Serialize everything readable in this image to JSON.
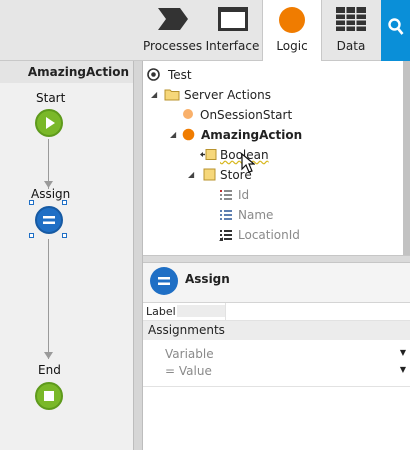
{
  "tabs": [
    {
      "label": "Processes",
      "icon": "processes-icon"
    },
    {
      "label": "Interface",
      "icon": "interface-icon"
    },
    {
      "label": "Logic",
      "icon": "logic-icon",
      "active": true
    },
    {
      "label": "Data",
      "icon": "data-icon"
    }
  ],
  "search": {
    "icon": "search-icon"
  },
  "canvas": {
    "title": "AmazingAction",
    "nodes": {
      "start": "Start",
      "assign": "Assign",
      "end": "End"
    }
  },
  "tree": {
    "rows": [
      {
        "label": "Test",
        "icon": "module-icon"
      },
      {
        "label": "Server Actions",
        "icon": "folder-icon"
      },
      {
        "label": "OnSessionStart",
        "icon": "action-icon"
      },
      {
        "label": "AmazingAction",
        "icon": "action-icon"
      },
      {
        "label": "Boolean",
        "icon": "input-param-icon"
      },
      {
        "label": "Store",
        "icon": "structure-icon"
      },
      {
        "label": "Id",
        "icon": "id-attribute-icon"
      },
      {
        "label": "Name",
        "icon": "text-attribute-icon"
      },
      {
        "label": "LocationId",
        "icon": "reference-attribute-icon"
      }
    ]
  },
  "props": {
    "title": "Assign",
    "label_key": "Label",
    "label_value": "",
    "section": "Assignments",
    "variable_placeholder": "Variable",
    "value_placeholder": "= Value"
  },
  "colors": {
    "accent": "#0a8fd8",
    "logic_orange": "#f07c00",
    "start_green": "#7ab829",
    "assign_blue": "#1f6fc5"
  }
}
